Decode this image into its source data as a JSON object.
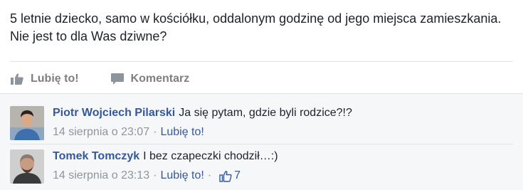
{
  "post": {
    "text": "5 letnie dziecko, samo w kościółku, oddalonym godzinę od jego miejsca zamieszkania. Nie jest to dla Was dziwne?"
  },
  "actions": {
    "like_label": "Lubię to!",
    "comment_label": "Komentarz"
  },
  "comments": [
    {
      "author": "Piotr Wojciech Pilarski",
      "text": "Ja się pytam, gdzie byli rodzice?!?",
      "timestamp": "14 sierpnia o 23:07",
      "like_label": "Lubię to!",
      "avatar_icon": "user-avatar"
    },
    {
      "author": "Tomek Tomczyk",
      "text": "I bez czapeczki chodził…:)",
      "timestamp": "14 sierpnia o 23:13",
      "like_label": "Lubię to!",
      "like_count": "7",
      "avatar_icon": "user-avatar"
    }
  ],
  "colors": {
    "link": "#365899",
    "meta": "#90949c",
    "action": "#7f7f7f",
    "comments_bg": "#f6f7f9"
  }
}
